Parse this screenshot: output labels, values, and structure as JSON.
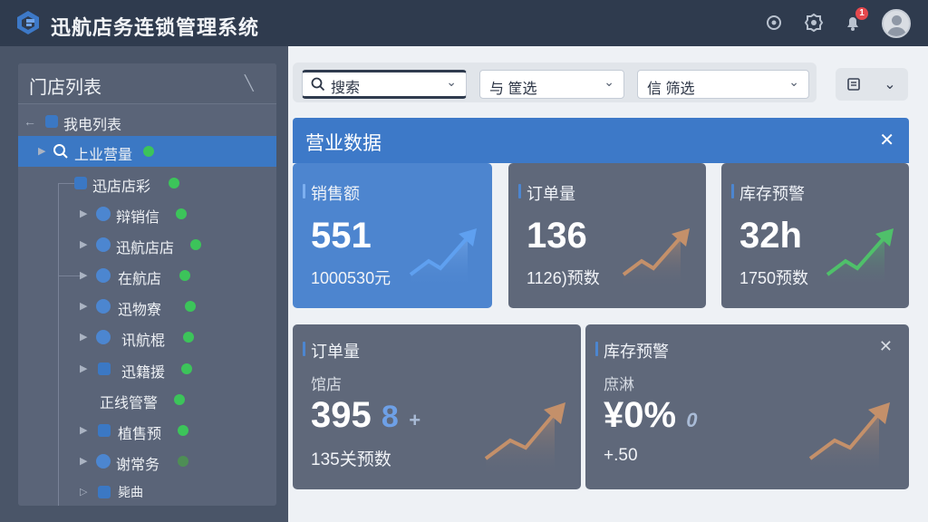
{
  "header": {
    "title": "迅航店务连锁管理系统",
    "notification_count": "1",
    "icons": [
      "settings-icon",
      "gear-icon",
      "bell-icon",
      "avatar"
    ]
  },
  "sidebar": {
    "title": "门店列表",
    "items": [
      {
        "label": "我电列表",
        "level": 0
      },
      {
        "label": "上业营量",
        "level": 1,
        "active": true
      },
      {
        "label": "迅店店彩",
        "level": 2
      },
      {
        "label": "辩销信",
        "level": 3
      },
      {
        "label": "迅航店店",
        "level": 3
      },
      {
        "label": "在航店",
        "level": 3
      },
      {
        "label": "迅物寮",
        "level": 3
      },
      {
        "label": "讯航棍",
        "level": 3
      },
      {
        "label": "迅籍援",
        "level": 3
      },
      {
        "label": "正线管警",
        "level": 3
      },
      {
        "label": "植售预",
        "level": 3
      },
      {
        "label": "谢常务",
        "level": 3
      },
      {
        "label": "毙曲",
        "level": 3
      }
    ]
  },
  "toolbar": {
    "search_label": "搜索",
    "filter1_label": "与 筐选",
    "filter2_label": "信 筛选"
  },
  "panel": {
    "title": "营业数据"
  },
  "cards": {
    "sales": {
      "label": "销售额",
      "value": "551",
      "sub": "1000530元"
    },
    "orders": {
      "label": "订单量",
      "value": "136",
      "sub": "1126)预数"
    },
    "stock": {
      "label": "库存预警",
      "value": "32h",
      "sub": "1750预数"
    },
    "orders2": {
      "label": "订单量",
      "caption": "馆店",
      "value": "395",
      "accent": "8",
      "accent_small": "+",
      "sub": "135关预数"
    },
    "stock2": {
      "label": "库存预警",
      "caption": "庶淋",
      "value": "¥0%",
      "accent_small": "0",
      "sub": "+.50"
    }
  },
  "colors": {
    "header_bg": "#2f3b4e",
    "accent_blue": "#3d79c8",
    "card_bg": "#5f687a",
    "status_green": "#3cc45a"
  }
}
